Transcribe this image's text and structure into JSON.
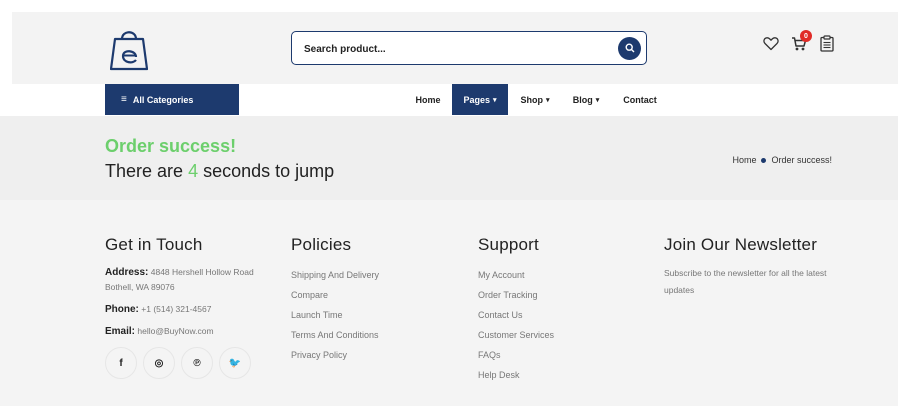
{
  "header": {
    "search_placeholder": "Search product...",
    "cart_count": "0"
  },
  "nav": {
    "all_categories": "All Categories",
    "items": [
      {
        "label": "Home"
      },
      {
        "label": "Pages"
      },
      {
        "label": "Shop"
      },
      {
        "label": "Blog"
      },
      {
        "label": "Contact"
      }
    ],
    "active": "Pages",
    "accent_color": "#1d3a6e"
  },
  "banner": {
    "title": "Order success!",
    "jump_prefix": "There are",
    "seconds": "4",
    "jump_suffix": "seconds to jump",
    "breadcrumb": {
      "home": "Home",
      "current": "Order success!"
    },
    "success_color": "#6ccf6c"
  },
  "footer": {
    "contact": {
      "title": "Get in Touch",
      "address_label": "Address:",
      "address_value": "4848 Hershell Hollow Road Bothell, WA 89076",
      "phone_label": "Phone:",
      "phone_value": "+1 (514) 321-4567",
      "email_label": "Email:",
      "email_value": "hello@BuyNow.com",
      "socials": [
        {
          "icon": "facebook-icon",
          "glyph": "f"
        },
        {
          "icon": "instagram-icon",
          "glyph": "◎"
        },
        {
          "icon": "pinterest-icon",
          "glyph": "℗"
        },
        {
          "icon": "twitter-icon",
          "glyph": "🐦"
        }
      ]
    },
    "policies": {
      "title": "Policies",
      "links": [
        "Shipping And Delivery",
        "Compare",
        "Launch Time",
        "Terms And Conditions",
        "Privacy Policy"
      ]
    },
    "support": {
      "title": "Support",
      "links": [
        "My Account",
        "Order Tracking",
        "Contact Us",
        "Customer Services",
        "FAQs",
        "Help Desk"
      ]
    },
    "newsletter": {
      "title": "Join Our Newsletter",
      "text": "Subscribe to the newsletter for all the latest updates"
    }
  }
}
